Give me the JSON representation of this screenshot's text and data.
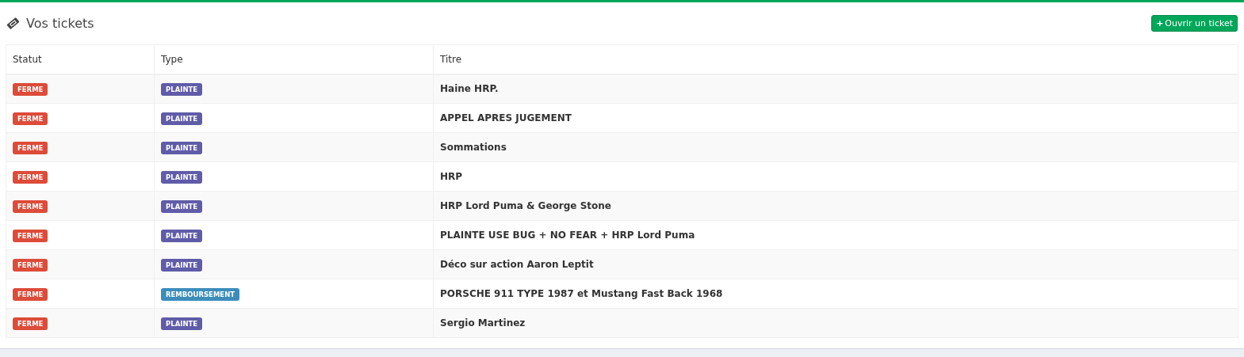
{
  "header": {
    "title": "Vos tickets",
    "button": {
      "icon": "+",
      "label": "Ouvrir un ticket"
    }
  },
  "table": {
    "columns": [
      "Statut",
      "Type",
      "Titre"
    ],
    "rows": [
      {
        "status": {
          "label": "FERME",
          "color": "#dd4b39"
        },
        "type": {
          "label": "PLAINTE",
          "color": "#605ca8"
        },
        "title": "Haine HRP."
      },
      {
        "status": {
          "label": "FERME",
          "color": "#dd4b39"
        },
        "type": {
          "label": "PLAINTE",
          "color": "#605ca8"
        },
        "title": "APPEL APRES JUGEMENT"
      },
      {
        "status": {
          "label": "FERME",
          "color": "#dd4b39"
        },
        "type": {
          "label": "PLAINTE",
          "color": "#605ca8"
        },
        "title": "Sommations"
      },
      {
        "status": {
          "label": "FERME",
          "color": "#dd4b39"
        },
        "type": {
          "label": "PLAINTE",
          "color": "#605ca8"
        },
        "title": "HRP"
      },
      {
        "status": {
          "label": "FERME",
          "color": "#dd4b39"
        },
        "type": {
          "label": "PLAINTE",
          "color": "#605ca8"
        },
        "title": "HRP Lord Puma & George Stone"
      },
      {
        "status": {
          "label": "FERME",
          "color": "#dd4b39"
        },
        "type": {
          "label": "PLAINTE",
          "color": "#605ca8"
        },
        "title": "PLAINTE USE BUG + NO FEAR + HRP Lord Puma"
      },
      {
        "status": {
          "label": "FERME",
          "color": "#dd4b39"
        },
        "type": {
          "label": "PLAINTE",
          "color": "#605ca8"
        },
        "title": "Déco sur action Aaron Leptit"
      },
      {
        "status": {
          "label": "FERME",
          "color": "#dd4b39"
        },
        "type": {
          "label": "REMBOURSEMENT",
          "color": "#3c8dbc"
        },
        "title": "PORSCHE 911 TYPE 1987 et Mustang Fast Back 1968"
      },
      {
        "status": {
          "label": "FERME",
          "color": "#dd4b39"
        },
        "type": {
          "label": "PLAINTE",
          "color": "#605ca8"
        },
        "title": "Sergio Martinez"
      }
    ]
  }
}
